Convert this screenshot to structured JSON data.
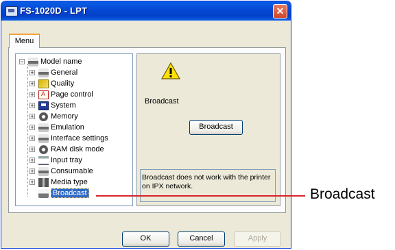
{
  "window": {
    "title": "FS-1020D - LPT",
    "close_glyph": "✕"
  },
  "tabs": [
    {
      "label": "Menu",
      "selected": true
    }
  ],
  "tree": {
    "root": {
      "label": "Model name",
      "expander": "−"
    },
    "items": [
      {
        "label": "General",
        "icon": "printer-icon",
        "expander": "+"
      },
      {
        "label": "Quality",
        "icon": "quality-icon",
        "expander": "+"
      },
      {
        "label": "Page control",
        "icon": "page-control-icon",
        "expander": "+"
      },
      {
        "label": "System",
        "icon": "system-icon",
        "expander": "+"
      },
      {
        "label": "Memory",
        "icon": "memory-icon",
        "expander": "+"
      },
      {
        "label": "Emulation",
        "icon": "printer-icon",
        "expander": "+"
      },
      {
        "label": "Interface settings",
        "icon": "printer-icon",
        "expander": "+"
      },
      {
        "label": "RAM disk mode",
        "icon": "ram-disk-icon",
        "expander": "+"
      },
      {
        "label": "Input tray",
        "icon": "tray-icon",
        "expander": "+"
      },
      {
        "label": "Consumable",
        "icon": "printer-icon",
        "expander": "+"
      },
      {
        "label": "Media type",
        "icon": "media-icon",
        "expander": "+"
      },
      {
        "label": "Broadcast",
        "icon": "broadcast-icon",
        "expander": "",
        "selected": true
      }
    ]
  },
  "detail": {
    "heading": "Broadcast",
    "button_label": "Broadcast",
    "note": "Broadcast does not work with the printer on IPX network."
  },
  "footer": {
    "ok_label": "OK",
    "cancel_label": "Cancel",
    "apply_label": "Apply",
    "apply_enabled": false
  },
  "callout": {
    "label": "Broadcast",
    "color": "#d8232a"
  },
  "colors": {
    "title_bar": "#0548d4",
    "selection": "#316ac5",
    "tab_highlight": "#f3a33a"
  }
}
